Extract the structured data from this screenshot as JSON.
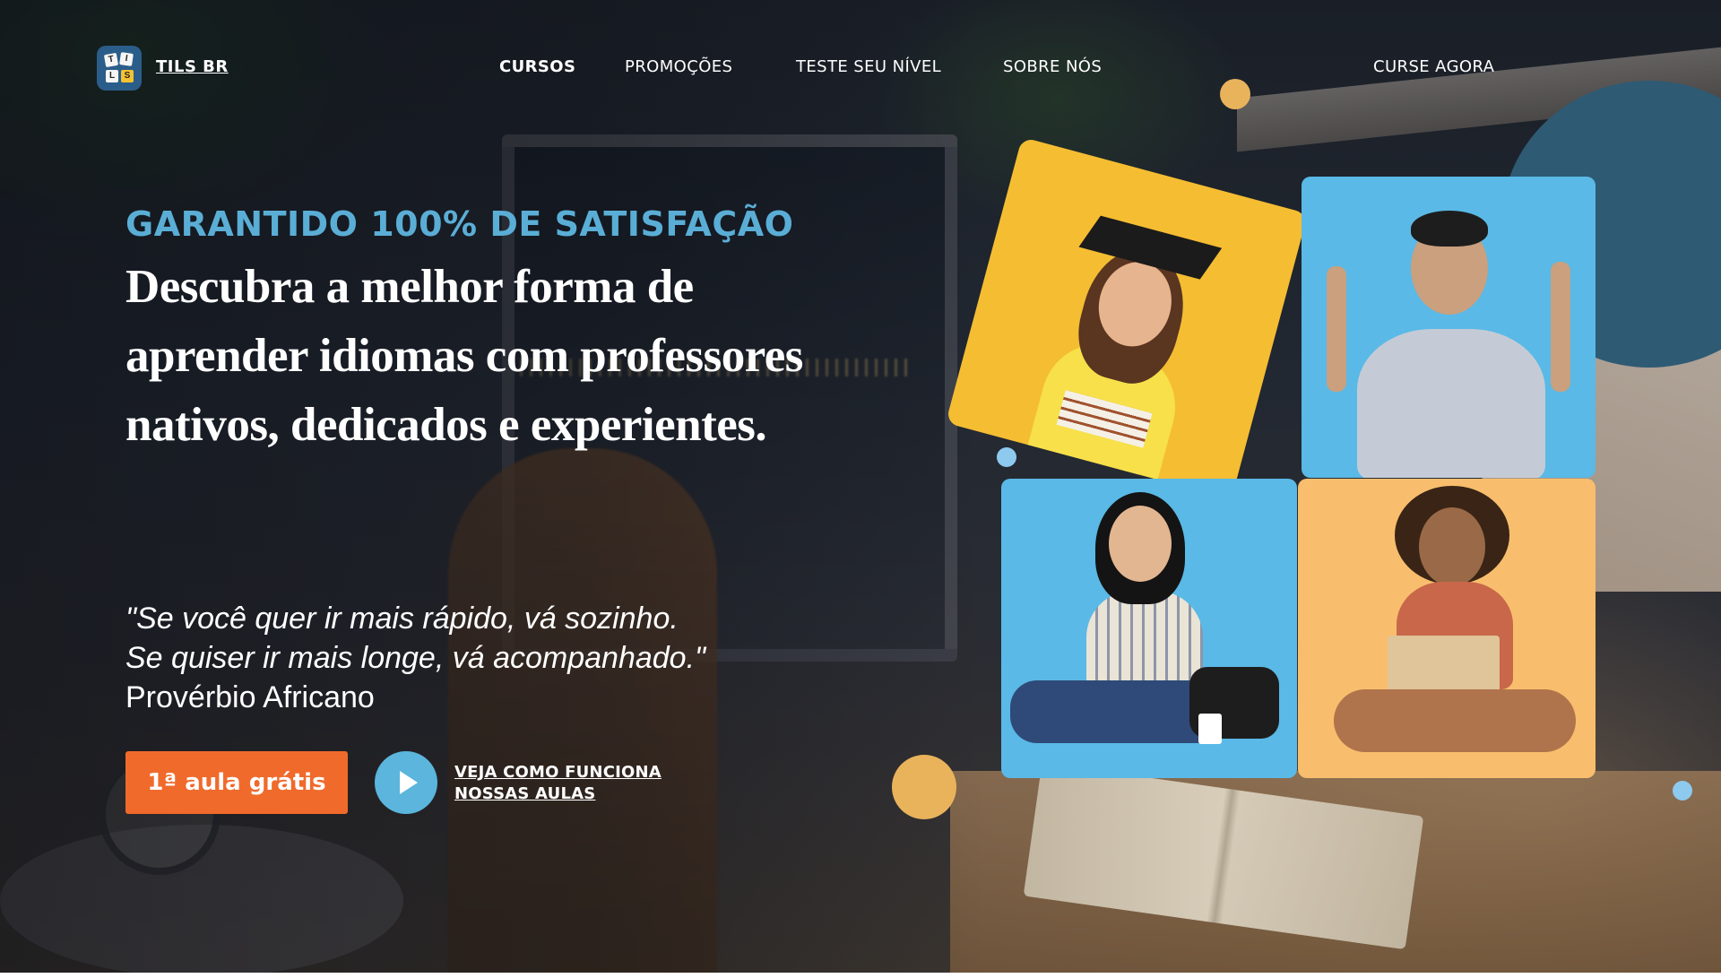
{
  "header": {
    "brand": "TILS BR",
    "logo_letters": [
      "T",
      "I",
      "L",
      "S"
    ],
    "nav": [
      {
        "label": "CURSOS",
        "active": true
      },
      {
        "label": "PROMOÇÕES",
        "active": false
      },
      {
        "label": "TESTE SEU NÍVEL",
        "active": false
      },
      {
        "label": "SOBRE NÓS",
        "active": false
      }
    ],
    "cta_label": "CURSE AGORA"
  },
  "hero": {
    "tagline": "GARANTIDO 100% DE SATISFAÇÃO",
    "headline": "Descubra a melhor forma de aprender idiomas com professores nativos, dedicados e experientes.",
    "quote_line1": "\"Se você quer ir mais rápido, vá sozinho.",
    "quote_line2": "Se quiser ir mais longe, vá acompanhado.\"",
    "quote_author": "Provérbio Africano",
    "primary_button": "1ª aula grátis",
    "video_link_line1": "VEJA COMO FUNCIONA",
    "video_link_line2": "NOSSAS AULAS"
  },
  "colors": {
    "accent_blue": "#5aaed6",
    "cta_orange": "#f06a2b",
    "play_blue": "#5bb5dc",
    "dot_orange": "#e9b35c",
    "photo_yellow": "#f5bd32",
    "photo_blue": "#5ab9e6",
    "photo_peach": "#f8be6d",
    "teal_circle": "#2e5a74"
  },
  "icons": {
    "play": "play-icon",
    "logo": "tils-logo-icon"
  }
}
